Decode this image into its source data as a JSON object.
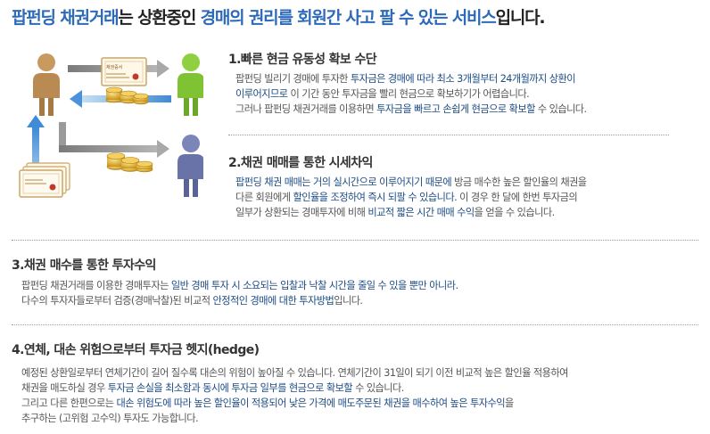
{
  "headline": {
    "part1": "팝펀딩 채권거래",
    "part2": "는 상환중인 ",
    "part3": "경매의 권리를 회원간 사고 팔 수 있는 서비스",
    "part4": "입니다."
  },
  "sections": [
    {
      "title": "1.빠른 현금 유동성 확보 수단",
      "lines": [
        [
          {
            "t": "팝펀딩 빌리기 경매에 투자한 "
          },
          {
            "t": "투자금은",
            "h": 1
          },
          {
            "t": " 경매에 따라 최소 3개월부터 24개월까지 상환이",
            "h": 1
          }
        ],
        [
          {
            "t": "이루어지므로",
            "h": 1
          },
          {
            "t": " 이 기간 동안 투자금을 빨리 현금으로 확보하기가 어렵습니다."
          }
        ],
        [
          {
            "t": "그러나 팝펀딩 채권거래를 이용하면 "
          },
          {
            "t": "투자금을 빠르고 손쉽게 현금으로 확보할",
            "h": 1
          },
          {
            "t": " 수 있습니다."
          }
        ]
      ]
    },
    {
      "title": "2.채권 매매를 통한 시세차익",
      "lines": [
        [
          {
            "t": "팝펀딩 채권 매매는 거의 실시간으로 이루어지기 때문에",
            "h": 1
          },
          {
            "t": " 방금 매수한 높은 할인율의 채권을"
          }
        ],
        [
          {
            "t": "다른 회원에게 "
          },
          {
            "t": "할인율을 조정하여 즉시 되팔 수 있습니다.",
            "h": 1
          },
          {
            "t": " 이 경우 한 달에 한번 투자금의"
          }
        ],
        [
          {
            "t": "일부가 상환되는 경매투자에 비해 "
          },
          {
            "t": "비교적 짧은 시간 매매 수익",
            "h": 1
          },
          {
            "t": "을 얻을 수 있습니다."
          }
        ]
      ]
    },
    {
      "title": "3.채권 매수를 통한 투자수익",
      "lines": [
        [
          {
            "t": "팝펀딩 채권거래를 이용한 경매투자는 "
          },
          {
            "t": "일반 경매 투자 시 소요되는 입찰과 낙찰 시간을 줄일 수 있을 뿐만 아니라.",
            "h": 1
          }
        ],
        [
          {
            "t": "다수의 투자자들로부터 검증(경매낙찰)된 비교적 "
          },
          {
            "t": "안정적인 경매에 대한 투자방법",
            "h": 1
          },
          {
            "t": "입니다."
          }
        ]
      ]
    },
    {
      "title": "4.연체, 대손 위험으로부터 투자금 헷지(hedge)",
      "lines": [
        [
          {
            "t": "예정된 상환일로부터 연체기간이 길어 질수록 대손의 위험이 높아질 수 있습니다. 연체기간이 31일이 되기 이전 비교적 높은 할인율 적용하여"
          }
        ],
        [
          {
            "t": "채권을 매도하실 경우 "
          },
          {
            "t": "투자금 손실을 최소함과 동시에 투자금 일부를 현금으로 확보할",
            "h": 1
          },
          {
            "t": " 수 있습니다."
          }
        ],
        [
          {
            "t": "그리고 다른 한편으로는 "
          },
          {
            "t": "대손 위험도에 따라 높은 할인율이 적용되어 낮은 가격에 매도주문된 채권을 매수하여 높은 투자수익",
            "h": 1
          },
          {
            "t": "을"
          }
        ],
        [
          {
            "t": "추구하는 (고위험 고수익) 투자도 가능합니다."
          }
        ]
      ]
    }
  ],
  "illustration": {
    "certificate_text": "채권증서",
    "colors": {
      "arrow_gray": "#8f8f8f",
      "arrow_blue": "#3f8bd6",
      "person_brown": "#b98a52",
      "person_green": "#7fc234",
      "person_purple": "#6a73a8",
      "coin_gold": "#d9a826"
    }
  }
}
